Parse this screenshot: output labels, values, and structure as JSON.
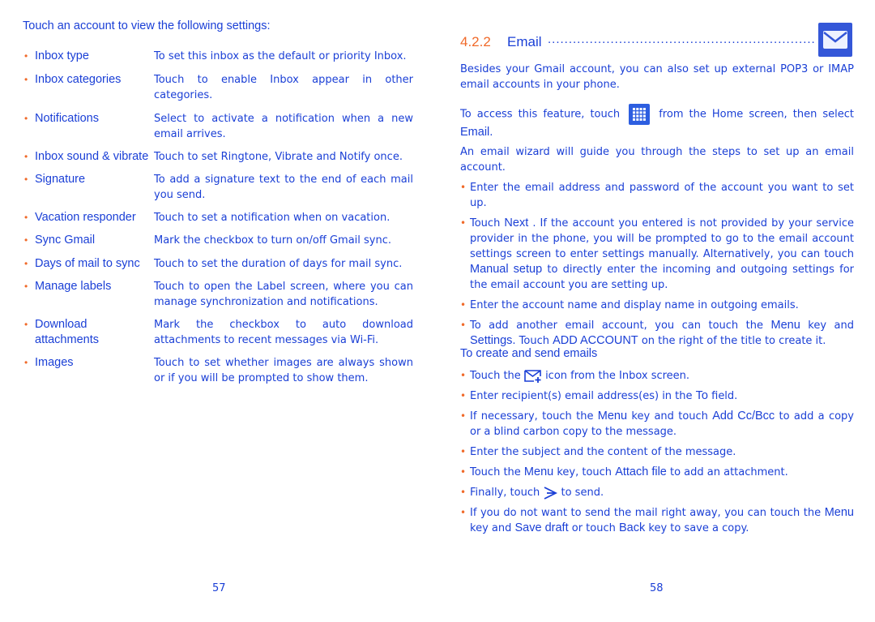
{
  "left_page": {
    "intro": "Touch an account to view the following settings:",
    "settings": [
      {
        "term": "Inbox type",
        "desc": "To set this inbox as the default or priority Inbox."
      },
      {
        "term": "Inbox categories",
        "desc": "Touch to enable Inbox appear in other categories."
      },
      {
        "term": "Notifications",
        "desc": "Select to activate a notification when a new email arrives."
      },
      {
        "term": "Inbox sound & vibrate",
        "desc": "Touch to set Ringtone, Vibrate and Notify once."
      },
      {
        "term": "Signature",
        "desc": "To add a signature text to the end of each mail you send."
      },
      {
        "term": "Vacation responder",
        "desc": "Touch to set a notification when on vacation."
      },
      {
        "term": "Sync Gmail",
        "desc": "Mark the checkbox to turn on/off Gmail sync."
      },
      {
        "term": "Days of mail to sync",
        "desc": "Touch to set the duration of days for mail sync."
      },
      {
        "term": "Manage labels",
        "desc": "Touch to open the Label screen, where you can manage synchronization and notifications."
      },
      {
        "term": "Download attachments",
        "desc": "Mark the checkbox to auto download attachments to recent messages via Wi-Fi."
      },
      {
        "term": "Images",
        "desc": "Touch to set whether images are always shown or if you will be prompted to show them."
      }
    ],
    "page_number": "57"
  },
  "right_page": {
    "section_number": "4.2.2",
    "section_title": "Email",
    "dots": "..............................................................................",
    "section_icon": "email-app-icon",
    "p1": "Besides your Gmail account, you can also set up external POP3 or IMAP email accounts in your phone.",
    "p2_a": "To access this feature, touch",
    "p2_icon": "apps-grid-icon",
    "p2_b": "from the Home screen, then select",
    "p2_ui": "Email",
    "p2_end": ".",
    "p3": "An email wizard will guide you through the steps to set up an email account.",
    "setup_items": {
      "i1": "Enter the email address and password of the account you want to set up.",
      "i2_a": "Touch",
      "i2_ui1": "Next",
      "i2_b": ". If the account you entered is not provided by your service provider in the phone, you will be prompted to go to the email account settings screen to enter settings manually. Alternatively, you can touch",
      "i2_ui2": "Manual setup",
      "i2_c": "to directly enter the incoming and outgoing settings for the email account you are setting up.",
      "i3": "Enter the account name and display name in outgoing emails.",
      "i4_a": "To add another email account, you can touch the",
      "i4_ui1": "Menu",
      "i4_b": "key and",
      "i4_ui2": "Settings",
      "i4_c": ". Touch",
      "i4_ui3": "ADD ACCOUNT",
      "i4_d": "on the right of the title to create it."
    },
    "subheading": "To create and send emails",
    "send_items": {
      "s1_a": "Touch the",
      "s1_icon": "compose-mail-icon",
      "s1_b": "icon from the Inbox screen.",
      "s2_a": "Enter recipient(s) email address(es) in the",
      "s2_ui": "To",
      "s2_b": "field.",
      "s3_a": "If necessary, touch the",
      "s3_ui1": "Menu",
      "s3_b": "key and touch",
      "s3_ui2": "Add Cc/Bcc",
      "s3_c": "to add a copy or a blind carbon copy to the message.",
      "s4": "Enter the subject and the content of the message.",
      "s5_a": "Touch the",
      "s5_ui1": "Menu",
      "s5_b": "key, touch",
      "s5_ui2": "Attach file",
      "s5_c": "to add an attachment.",
      "s6_a": "Finally, touch",
      "s6_icon": "send-icon",
      "s6_b": "to send.",
      "s7_a": "If you do not want to send the mail right away, you can touch the",
      "s7_ui1": "Menu",
      "s7_b": "key and",
      "s7_ui2": "Save draft",
      "s7_c": "or touch",
      "s7_ui3": "Back",
      "s7_d": "key to save a copy."
    },
    "page_number": "58"
  },
  "colors": {
    "text": "#1a3fd6",
    "accent": "#f06a2a",
    "icon_bg": "#3457d8"
  }
}
